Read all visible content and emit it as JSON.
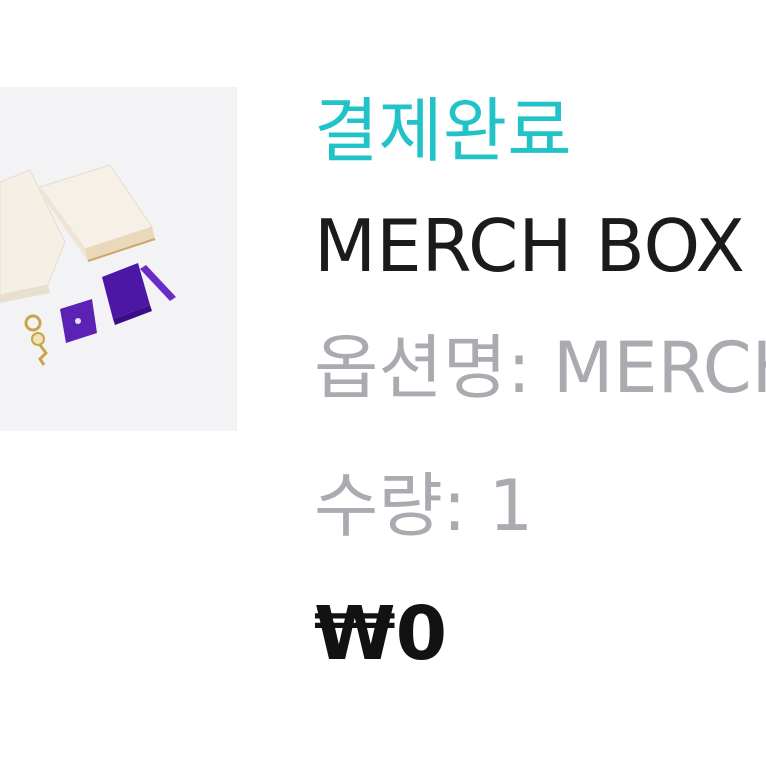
{
  "order_item": {
    "status": "결제완료",
    "product_name": "MERCH BOX",
    "option_label": "옵션명: MERCH BOX",
    "quantity_label": "수량: 1",
    "price": "₩0"
  },
  "thumbnail": {
    "icon": "merch-box-product-image",
    "colors": {
      "background": "#f3f3f5",
      "box": "#f4ece1",
      "box_accent": "#c9a86a",
      "purple": "#5b22b3",
      "gold": "#c9a44a"
    }
  },
  "colors": {
    "status": "#22c3c8",
    "product_name": "#1b1b1b",
    "secondary": "#a9abb0",
    "price": "#121212"
  }
}
